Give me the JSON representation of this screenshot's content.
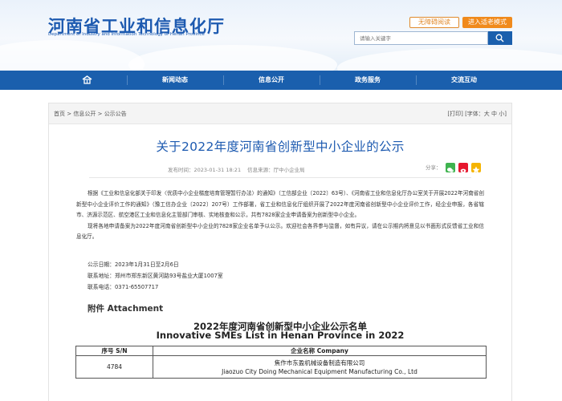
{
  "header": {
    "site_title": "河南省工业和信息化厅",
    "site_subtitle": "Department of Industry and Information Technology of Henan Province",
    "barrier_free_label": "无障碍阅读",
    "elder_mode_label": "进入适老模式",
    "search_placeholder": "请输入关键字"
  },
  "nav": {
    "items": [
      {
        "label": "新闻动态"
      },
      {
        "label": "信息公开"
      },
      {
        "label": "政务服务"
      },
      {
        "label": "交流互动"
      }
    ]
  },
  "breadcrumb": {
    "items": [
      "首页",
      "信息公开",
      "公示公告"
    ],
    "separator": ">",
    "print_label": "[打印]",
    "font_label": "[字体：",
    "font_large": "大",
    "font_medium": "中",
    "font_small": "小",
    "font_close": "]"
  },
  "article": {
    "title": "关于2022年度河南省创新型中小企业的公示",
    "publish_time": "发布时间：2023-01-31 18:21",
    "source": "信息来源：厅中小企业局",
    "share_label": "分享：",
    "paragraphs": [
      "根据《工业和信息化部关于印发〈优质中小企业梯度培育管理暂行办法〉的通知》（工信部企业〔2022〕63号）、《河南省工业和信息化厅办公室关于开展2022年河南省创新型中小企业评价工作的通知》（豫工信办企业〔2022〕207号）工作部署，省工业和信息化厅组织开展了2022年度河南省创新型中小企业评价工作，经企业申报，各省辖市、济源示范区、航空港区工业和信息化主管部门审核、实地核查和公示，共有7828家企业申请备案为创新型中小企业。",
      "现将各地申请备案为2022年度河南省创新型中小企业的7828家企业名单予以公示。欢迎社会各界参与监督，如有异议，请在公示期内将意见以书面形式反馈省工业和信息化厅。"
    ],
    "period": "公示日期：2023年1月31日至2月6日",
    "address": "联系地址：郑州市郑东新区黄河路93号盐业大厦1007室",
    "phone": "联系电话：0371-65507717"
  },
  "attachment": {
    "heading": "附件 Attachment",
    "list_title_cn": "2022年度河南省创新型中小企业公示名单",
    "list_title_en": "Innovative SMEs List in Henan Province in 2022",
    "columns": [
      "序号 S/N",
      "企业名称 Company"
    ],
    "rows": [
      {
        "no": "4784",
        "name_cn": "焦作市东盈机械设备制造有限公司",
        "name_en": "Jiaozuo City Doing Mechanical Equipment Manufacturing Co., Ltd"
      }
    ]
  },
  "colors": {
    "brand_blue": "#1a5fad",
    "title_blue": "#1d5ab0",
    "orange": "#f08a1c"
  }
}
